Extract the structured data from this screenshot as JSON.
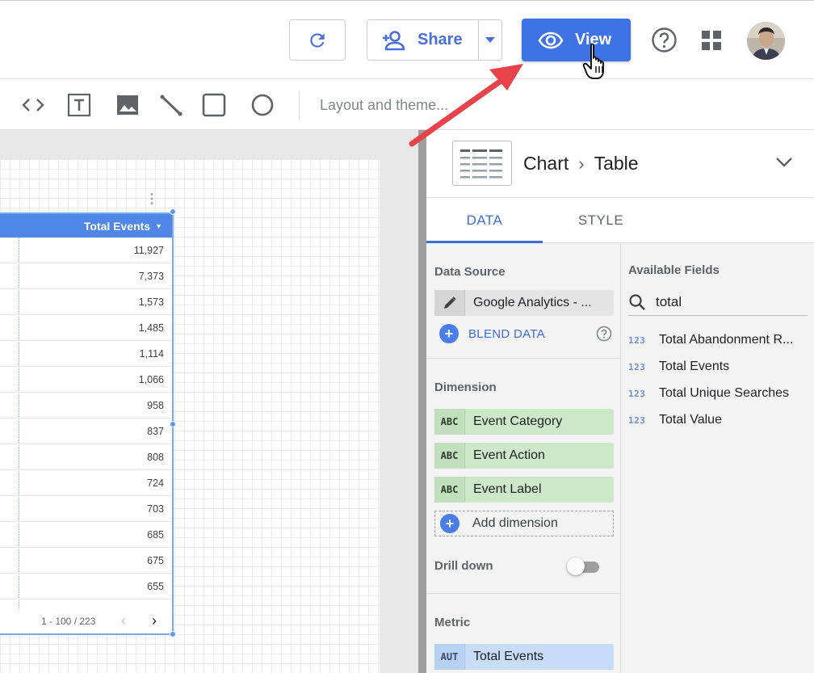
{
  "header": {
    "refresh_icon": "refresh-icon",
    "share_label": "Share",
    "view_label": "View",
    "help_icon": "help-circle-icon",
    "apps_icon": "apps-grid-icon",
    "colors": {
      "primary": "#3f72e5",
      "share_text": "#4a6fdc"
    }
  },
  "toolbar": {
    "tools": [
      "code-icon",
      "text-box-icon",
      "image-icon",
      "line-icon",
      "rectangle-icon",
      "circle-icon"
    ],
    "layout_theme_label": "Layout and theme..."
  },
  "table": {
    "header": "Total Events",
    "rows": [
      "11,927",
      "7,373",
      "1,573",
      "1,485",
      "1,114",
      "1,066",
      "958",
      "837",
      "808",
      "724",
      "703",
      "685",
      "675",
      "655"
    ],
    "pager_text": "1 - 100 / 223"
  },
  "panel": {
    "chart_crumb": "Chart",
    "chart_type": "Table",
    "tabs": {
      "data": "DATA",
      "style": "STYLE"
    },
    "data_source": {
      "label": "Data Source",
      "value": "Google Analytics - ...",
      "blend_label": "BLEND DATA"
    },
    "dimension": {
      "label": "Dimension",
      "badge": "ABC",
      "items": [
        "Event Category",
        "Event Action",
        "Event Label"
      ],
      "add_label": "Add dimension"
    },
    "drill_down": {
      "label": "Drill down",
      "enabled": false
    },
    "metric": {
      "label": "Metric",
      "badge": "AUT",
      "items": [
        "Total Events"
      ]
    },
    "available_fields": {
      "label": "Available Fields",
      "search_value": "total",
      "badge": "123",
      "items": [
        "Total Abandonment R...",
        "Total Events",
        "Total Unique Searches",
        "Total Value"
      ]
    }
  },
  "annotation_color": "#e8434a"
}
